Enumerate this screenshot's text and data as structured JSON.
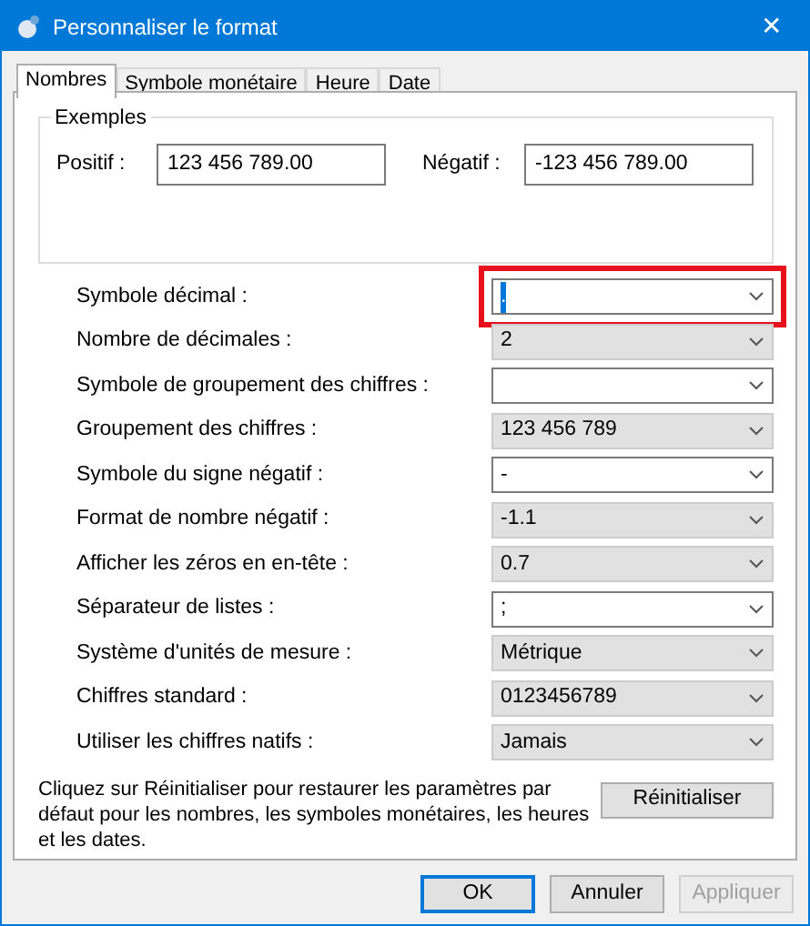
{
  "window": {
    "title": "Personnaliser le format",
    "close": "✕"
  },
  "tabs": [
    {
      "label": "Nombres",
      "selected": true
    },
    {
      "label": "Symbole monétaire",
      "selected": false
    },
    {
      "label": "Heure",
      "selected": false
    },
    {
      "label": "Date",
      "selected": false
    }
  ],
  "examples": {
    "title": "Exemples",
    "positive_label": "Positif :",
    "positive_value": "123 456 789.00",
    "negative_label": "Négatif :",
    "negative_value": "-123 456 789.00"
  },
  "settings": [
    {
      "label": "Symbole décimal :",
      "value": ".",
      "kind": "editable",
      "highlighted": true,
      "text_selected": true
    },
    {
      "label": "Nombre de décimales :",
      "value": "2",
      "kind": "list",
      "highlighted": false,
      "text_selected": false
    },
    {
      "label": "Symbole de groupement des chiffres :",
      "kind": "editable",
      "highlighted": false
    },
    {
      "label": "Groupement des chiffres :",
      "value": "123 456 789",
      "kind": "list",
      "highlighted": false,
      "text_selected": false
    },
    {
      "label": "Symbole du signe négatif :",
      "value": "-",
      "kind": "editable",
      "highlighted": false,
      "text_selected": false
    },
    {
      "label": "Format de nombre négatif :",
      "value": "-1.1",
      "kind": "list",
      "highlighted": false,
      "text_selected": false
    },
    {
      "label": "Afficher les zéros en en-tête :",
      "value": "0.7",
      "kind": "list",
      "highlighted": false,
      "text_selected": false
    },
    {
      "label": "Séparateur de listes :",
      "value": ";",
      "kind": "editable",
      "highlighted": false,
      "text_selected": false
    },
    {
      "label": "Système d'unités de mesure :",
      "value": "Métrique",
      "kind": "list",
      "highlighted": false,
      "text_selected": false
    },
    {
      "label": "Chiffres standard :",
      "value": "0123456789",
      "kind": "list",
      "highlighted": false,
      "text_selected": false
    },
    {
      "label": "Utiliser les chiffres natifs :",
      "value": "Jamais",
      "kind": "list",
      "highlighted": false,
      "text_selected": false
    }
  ],
  "reset": {
    "text": "Cliquez sur Réinitialiser pour restaurer les paramètres par défaut pour les nombres, les symboles monétaires, les heures et les dates.",
    "button": "Réinitialiser"
  },
  "buttons": [
    {
      "label": "OK",
      "default": true,
      "disabled": false
    },
    {
      "label": "Annuler",
      "default": false,
      "disabled": false
    },
    {
      "label": "Appliquer",
      "default": false,
      "disabled": true
    }
  ]
}
